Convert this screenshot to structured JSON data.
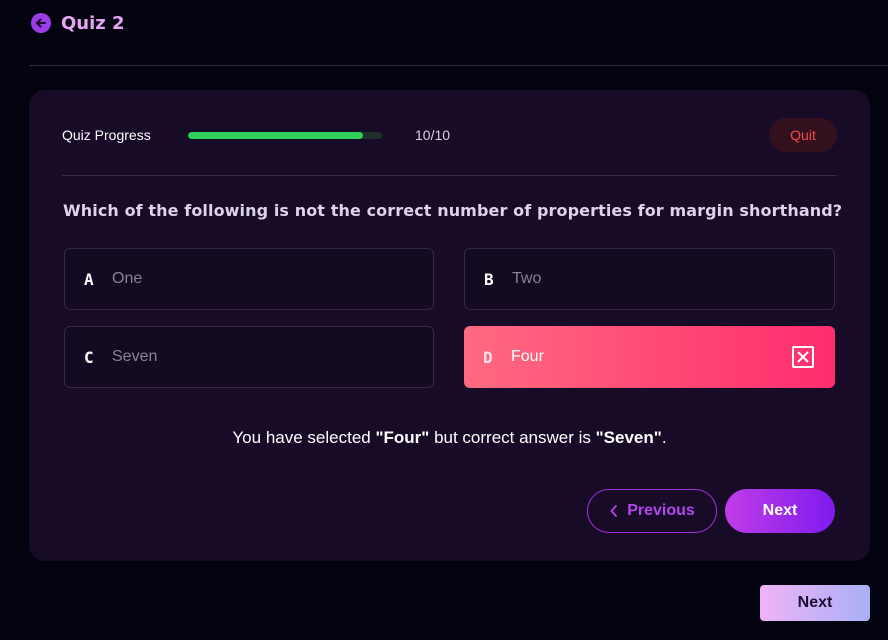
{
  "header": {
    "title": "Quiz 2",
    "back_icon": "arrow-left-icon"
  },
  "progress": {
    "label": "Quiz Progress",
    "count": "10/10",
    "fraction": 0.9
  },
  "quit_label": "Quit",
  "question": "Which of the following is not the correct number of properties for margin shorthand?",
  "options": [
    {
      "letter": "A",
      "text": "One",
      "state": "default"
    },
    {
      "letter": "B",
      "text": "Two",
      "state": "default"
    },
    {
      "letter": "C",
      "text": "Seven",
      "state": "default"
    },
    {
      "letter": "D",
      "text": "Four",
      "state": "selected-wrong"
    }
  ],
  "feedback": {
    "prefix": "You have selected ",
    "selected": "\"Four\"",
    "middle": " but correct answer is ",
    "correct": "\"Seven\"",
    "suffix": "."
  },
  "nav": {
    "previous_label": "Previous",
    "next_label": "Next"
  },
  "footer": {
    "next_label": "Next"
  },
  "colors": {
    "accent": "#9b3de6",
    "progress": "#2fcf59",
    "wrong_gradient_start": "#ff6a80",
    "wrong_gradient_end": "#ff2d6d",
    "quit_text": "#ef4a4a"
  }
}
